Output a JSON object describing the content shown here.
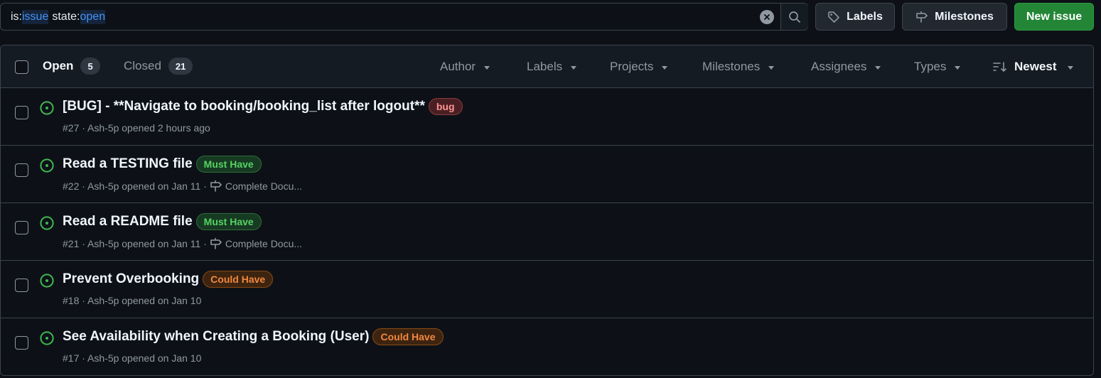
{
  "search": {
    "segments": [
      {
        "key": "is:",
        "value": "issue"
      },
      {
        "key": "state:",
        "value": "open"
      }
    ]
  },
  "toolbar": {
    "labels_label": "Labels",
    "milestones_label": "Milestones",
    "new_issue_label": "New issue"
  },
  "header": {
    "open_label": "Open",
    "open_count": "5",
    "closed_label": "Closed",
    "closed_count": "21",
    "filters": [
      "Author",
      "Labels",
      "Projects",
      "Milestones",
      "Assignees",
      "Types"
    ],
    "sort_label": "Newest"
  },
  "issues": [
    {
      "title": "[BUG] - **Navigate to booking/booking_list after logout**",
      "label": {
        "text": "bug",
        "kind": "bug"
      },
      "meta": "#27 · Ash-5p opened 2 hours ago",
      "milestone": ""
    },
    {
      "title": "Read a TESTING file",
      "label": {
        "text": "Must Have",
        "kind": "must"
      },
      "meta": "#22 · Ash-5p opened on Jan 11 ·",
      "milestone": "Complete Docu..."
    },
    {
      "title": "Read a README file",
      "label": {
        "text": "Must Have",
        "kind": "must"
      },
      "meta": "#21 · Ash-5p opened on Jan 11 ·",
      "milestone": "Complete Docu..."
    },
    {
      "title": "Prevent Overbooking",
      "label": {
        "text": "Could Have",
        "kind": "could"
      },
      "meta": "#18 · Ash-5p opened on Jan 10",
      "milestone": ""
    },
    {
      "title": "See Availability when Creating a Booking (User)",
      "label": {
        "text": "Could Have",
        "kind": "could"
      },
      "meta": "#17 · Ash-5p opened on Jan 10",
      "milestone": ""
    }
  ],
  "colors": {
    "open_icon": "#3fb950",
    "new_issue_bg": "#238636",
    "bug_label": {
      "fg": "#ff9492",
      "bg": "#4a1f24",
      "border": "#8b3a40"
    },
    "must_label": {
      "fg": "#56d364",
      "bg": "#173a22",
      "border": "#2f6b3c"
    },
    "could_label": {
      "fg": "#f0883e",
      "bg": "#3d2410",
      "border": "#8a4a14"
    }
  }
}
